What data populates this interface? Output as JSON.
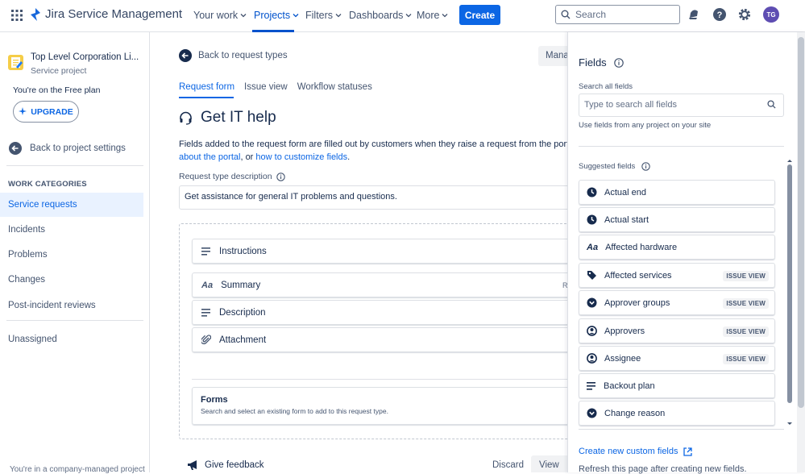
{
  "topnav": {
    "brand": "Jira Service Management",
    "items": [
      {
        "label": "Your work"
      },
      {
        "label": "Projects"
      },
      {
        "label": "Filters"
      },
      {
        "label": "Dashboards"
      },
      {
        "label": "More"
      }
    ],
    "create_label": "Create",
    "search_placeholder": "Search",
    "avatar_initials": "TG"
  },
  "sidebar": {
    "project_name": "Top Level Corporation Li...",
    "project_type": "Service project",
    "plan_text": "You're on the Free plan",
    "upgrade_label": "UPGRADE",
    "back_label": "Back to project settings",
    "section_heading": "WORK CATEGORIES",
    "items": [
      {
        "label": "Service requests"
      },
      {
        "label": "Incidents"
      },
      {
        "label": "Problems"
      },
      {
        "label": "Changes"
      },
      {
        "label": "Post-incident reviews"
      }
    ],
    "unassigned_label": "Unassigned",
    "footer_text": "You're in a company-managed project"
  },
  "main": {
    "back_label": "Back to request types",
    "manage_label": "Mana",
    "tabs": [
      {
        "label": "Request form"
      },
      {
        "label": "Issue view"
      },
      {
        "label": "Workflow statuses"
      }
    ],
    "title": "Get IT help",
    "desc_line1": "Fields added to the request form are filled out by customers when they raise a request from the port",
    "desc_link1": "about the portal",
    "desc_mid": ", or ",
    "desc_link2": "how to customize fields",
    "desc_end": ".",
    "rtd_label": "Request type description",
    "rtd_value": "Get assistance for general IT problems and questions.",
    "fields": [
      {
        "label": "Instructions",
        "icon": "lines-icon"
      },
      {
        "label": "Summary",
        "icon": "text-aa-icon",
        "tag": "R"
      },
      {
        "label": "Description",
        "icon": "lines-icon"
      },
      {
        "label": "Attachment",
        "icon": "paperclip-icon"
      }
    ],
    "forms_title": "Forms",
    "forms_sub": "Search and select an existing form to add to this request type.",
    "feedback_label": "Give feedback",
    "discard_label": "Discard",
    "view_label": "View"
  },
  "panel": {
    "title": "Fields",
    "search_label": "Search all fields",
    "search_placeholder": "Type to search all fields",
    "use_fields_text": "Use fields from any project on your site",
    "suggested_label": "Suggested fields",
    "items": [
      {
        "label": "Actual end",
        "icon": "clock-icon",
        "badge": ""
      },
      {
        "label": "Actual start",
        "icon": "clock-icon",
        "badge": ""
      },
      {
        "label": "Affected hardware",
        "icon": "text-aa-icon",
        "badge": ""
      },
      {
        "label": "Affected services",
        "icon": "tag-icon",
        "badge": "ISSUE VIEW"
      },
      {
        "label": "Approver groups",
        "icon": "chevron-circle-icon",
        "badge": "ISSUE VIEW"
      },
      {
        "label": "Approvers",
        "icon": "person-circle-icon",
        "badge": "ISSUE VIEW"
      },
      {
        "label": "Assignee",
        "icon": "person-circle-icon",
        "badge": "ISSUE VIEW"
      },
      {
        "label": "Backout plan",
        "icon": "lines-icon",
        "badge": ""
      },
      {
        "label": "Change reason",
        "icon": "chevron-circle-icon",
        "badge": ""
      }
    ],
    "create_custom_label": "Create new custom fields",
    "refresh_text": "Refresh this page after creating new fields."
  }
}
